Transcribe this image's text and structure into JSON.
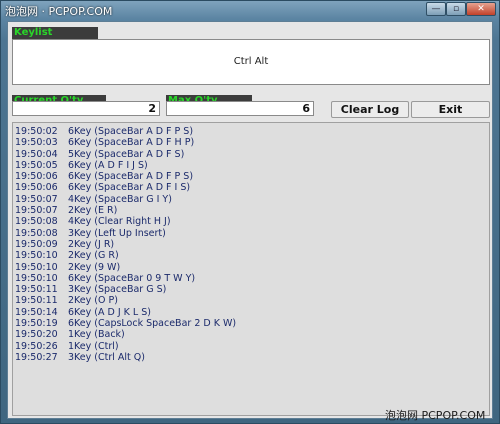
{
  "titlebar": {
    "watermark": "泡泡网 · PCPOP.COM",
    "min_label": "—",
    "max_label": "▫",
    "close_label": "✕"
  },
  "keylist": {
    "label": "Keylist",
    "value": "Ctrl Alt"
  },
  "current_qty": {
    "label": "Current Q'ty",
    "value": "2"
  },
  "max_qty": {
    "label": "Max Q'ty",
    "value": "6"
  },
  "buttons": {
    "clear_log": "Clear Log",
    "exit": "Exit"
  },
  "log": [
    {
      "time": "19:50:02",
      "text": "6Key (SpaceBar A D F P S)"
    },
    {
      "time": "19:50:03",
      "text": "6Key (SpaceBar A D F H P)"
    },
    {
      "time": "19:50:04",
      "text": "5Key (SpaceBar A D F S)"
    },
    {
      "time": "19:50:05",
      "text": "6Key (A D F I J S)"
    },
    {
      "time": "19:50:06",
      "text": "6Key (SpaceBar A D F P S)"
    },
    {
      "time": "19:50:06",
      "text": "6Key (SpaceBar A D F I S)"
    },
    {
      "time": "19:50:07",
      "text": "4Key (SpaceBar G I Y)"
    },
    {
      "time": "19:50:07",
      "text": "2Key (E R)"
    },
    {
      "time": "19:50:08",
      "text": "4Key (Clear Right H J)"
    },
    {
      "time": "19:50:08",
      "text": "3Key (Left Up Insert)"
    },
    {
      "time": "19:50:09",
      "text": "2Key (J R)"
    },
    {
      "time": "19:50:10",
      "text": "2Key (G R)"
    },
    {
      "time": "19:50:10",
      "text": "2Key (9 W)"
    },
    {
      "time": "19:50:10",
      "text": "6Key (SpaceBar 0 9 T W Y)"
    },
    {
      "time": "19:50:11",
      "text": "3Key (SpaceBar G S)"
    },
    {
      "time": "19:50:11",
      "text": "2Key (O P)"
    },
    {
      "time": "19:50:14",
      "text": "6Key (A D J K L S)"
    },
    {
      "time": "19:50:19",
      "text": "6Key (CapsLock SpaceBar 2 D K W)"
    },
    {
      "time": "19:50:20",
      "text": "1Key (Back)"
    },
    {
      "time": "19:50:26",
      "text": "1Key (Ctrl)"
    },
    {
      "time": "19:50:27",
      "text": "3Key (Ctrl Alt Q)"
    }
  ],
  "footer": {
    "watermark": "泡泡网 PCPOP.COM"
  },
  "colors": {
    "label_bg": "#3c3c3c",
    "label_text": "#29d629",
    "log_text": "#1b2a6b"
  }
}
